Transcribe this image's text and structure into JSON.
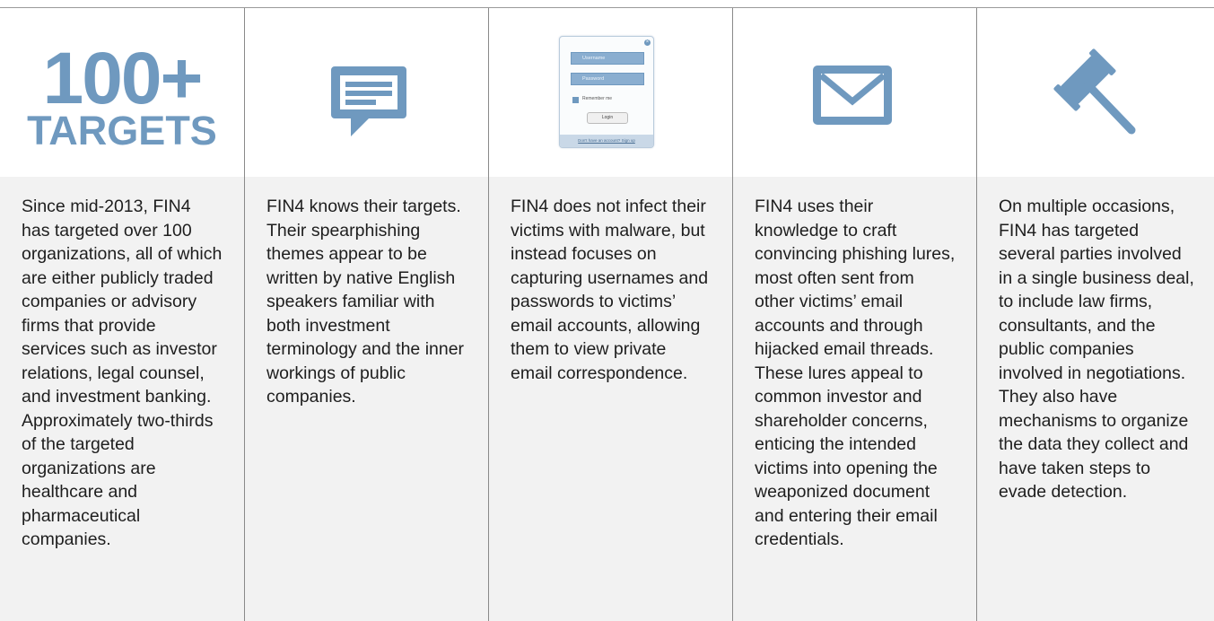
{
  "colors": {
    "accent": "#6f99bf",
    "panel_bg": "#f2f2f2",
    "divider": "#8a8a8a"
  },
  "columns": [
    {
      "headline_number": "100+",
      "headline_word": "TARGETS",
      "text": "Since mid-2013, FIN4 has targeted over 100 organizations, all of which are either publicly traded companies or advisory firms that provide services such as investor relations, legal counsel, and investment banking. Approximately two-thirds of the targeted organizations are healthcare and pharmaceutical companies."
    },
    {
      "icon": "speech-bubble-icon",
      "text": "FIN4 knows their targets. Their spearphishing themes appear to be written by native English speakers familiar with both investment terminology and the inner workings of public companies."
    },
    {
      "icon": "login-form-image",
      "login": {
        "username": "Username",
        "password": "Password",
        "remember": "Remember me",
        "button": "Login",
        "footer": "Don't have an account? Sign up"
      },
      "text": "FIN4 does not infect their victims with malware, but instead focuses on capturing usernames and passwords to victims’ email accounts, allowing them to view private email correspondence."
    },
    {
      "icon": "envelope-icon",
      "text": "FIN4 uses their knowledge to craft convincing phishing lures, most often sent from other victims’ email accounts and through hijacked email threads. These lures appeal to common investor and shareholder concerns, enticing the intended victims into opening the weaponized document and entering their email credentials."
    },
    {
      "icon": "gavel-icon",
      "text": "On multiple occasions, FIN4 has targeted several parties involved in a single business deal, to include law firms, consultants, and the public companies involved in negotiations. They also have mechanisms to organize the data they collect and have taken steps to evade detection."
    }
  ]
}
